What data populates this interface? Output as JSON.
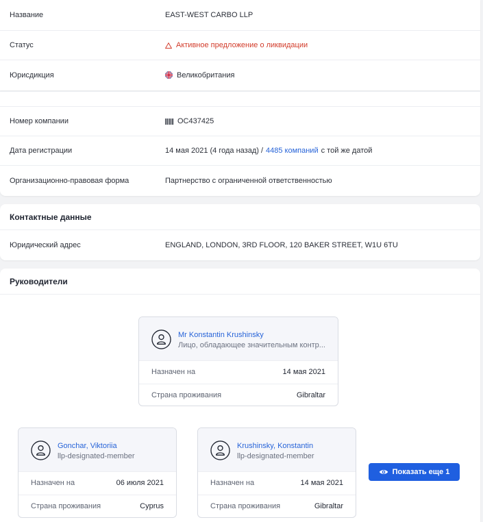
{
  "company": {
    "rows": [
      {
        "key": "Название",
        "value": "EAST-WEST CARBO LLP"
      },
      {
        "key": "Статус",
        "value": "Активное предложение о ликвидации"
      },
      {
        "key": "Юрисдикция",
        "value": "Великобритания"
      }
    ],
    "rows2": [
      {
        "key": "Номер компании",
        "value": "OC437425"
      },
      {
        "key": "Дата регистрации",
        "value_pre": "14 мая 2021 (4 года назад) /",
        "value_link": "4485 компаний",
        "value_post": "с той же датой"
      },
      {
        "key": "Организационно-правовая форма",
        "value": "Партнерство с ограниченной ответственностью"
      }
    ]
  },
  "contacts": {
    "title": "Контактные данные",
    "address_key": "Юридический адрес",
    "address_value": "ENGLAND, LONDON, 3RD FLOOR, 120 BAKER STREET, W1U 6TU"
  },
  "managers": {
    "title": "Руководители",
    "appointed_label": "Назначен на",
    "country_label": "Страна проживания",
    "cards": [
      {
        "name": "Mr Konstantin Krushinsky",
        "role": "Лицо, обладающее значительным контр...",
        "appointed": "14 мая 2021",
        "country": "Gibraltar"
      },
      {
        "name": "Gonchar, Viktoriia",
        "role": "llp-designated-member",
        "appointed": "06 июля 2021",
        "country": "Cyprus"
      },
      {
        "name": "Krushinsky, Konstantin",
        "role": "llp-designated-member",
        "appointed": "14 мая 2021",
        "country": "Gibraltar"
      }
    ],
    "show_more": "Показать еще 1"
  },
  "colors": {
    "accent": "#1f5fe0",
    "link": "#2663d8",
    "danger": "#d23b2a"
  }
}
